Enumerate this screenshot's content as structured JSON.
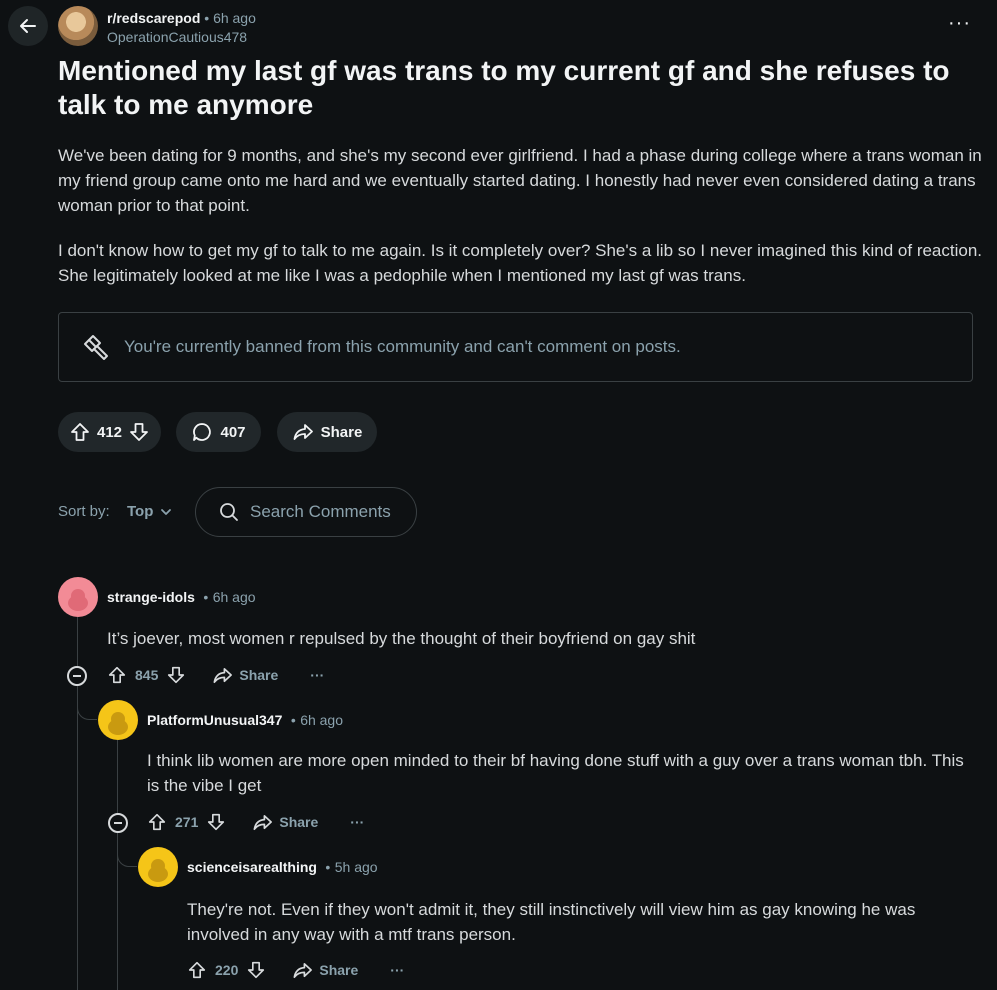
{
  "post": {
    "subreddit": "r/redscarepod",
    "separator": "•",
    "time": "6h ago",
    "author": "OperationCautious478",
    "more": "···",
    "title": "Mentioned my last gf was trans to my current gf and she refuses to talk to me anymore",
    "paragraphs": [
      "We've been dating for 9 months, and she's my second ever girlfriend. I had a phase during college where a trans woman in my friend group came onto me hard and we eventually started dating. I honestly had never even considered dating a trans woman prior to that point.",
      "I don't know how to get my gf to talk to me again. Is it completely over? She's a lib so I never imagined this kind of reaction. She legitimately looked at me like I was a pedophile when I mentioned my last gf was trans."
    ],
    "ban_notice": "You're currently banned from this community and can't comment on posts.",
    "votes": "412",
    "comments": "407",
    "share": "Share"
  },
  "sort": {
    "label": "Sort by:",
    "value": "Top"
  },
  "search": {
    "placeholder": "Search Comments"
  },
  "comments": [
    {
      "author": "strange-idols",
      "time": "6h ago",
      "text": "It’s joever, most women r repulsed by the thought of their boyfriend on gay shit",
      "votes": "845",
      "share": "Share",
      "more": "···",
      "avatar_color": "#f28b96"
    },
    {
      "author": "PlatformUnusual347",
      "time": "6h ago",
      "text": "I think lib women are more open minded to their bf having done stuff with a guy over a trans woman tbh. This is the vibe I get",
      "votes": "271",
      "share": "Share",
      "more": "···",
      "avatar_color": "#f5c518"
    },
    {
      "author": "scienceisarealthing",
      "time": "5h ago",
      "text": "They're not. Even if they won't admit it, they still instinctively will view him as gay knowing he was involved in any way with a mtf trans person.",
      "votes": "220",
      "share": "Share",
      "more": "···",
      "avatar_color": "#f5c518"
    }
  ],
  "icons": {
    "back": "arrow-left-icon",
    "upvote": "arrow-up-icon",
    "downvote": "arrow-down-icon",
    "comment": "speech-bubble-icon",
    "share": "share-arrow-icon",
    "ban": "hammer-icon",
    "search": "magnifier-icon",
    "sort": "chevron-down-icon",
    "collapse": "minus-circle-icon"
  },
  "colors": {
    "background": "#0e1113",
    "pill": "#21272a",
    "muted": "#8ba2ad",
    "text": "#d7dadc"
  }
}
